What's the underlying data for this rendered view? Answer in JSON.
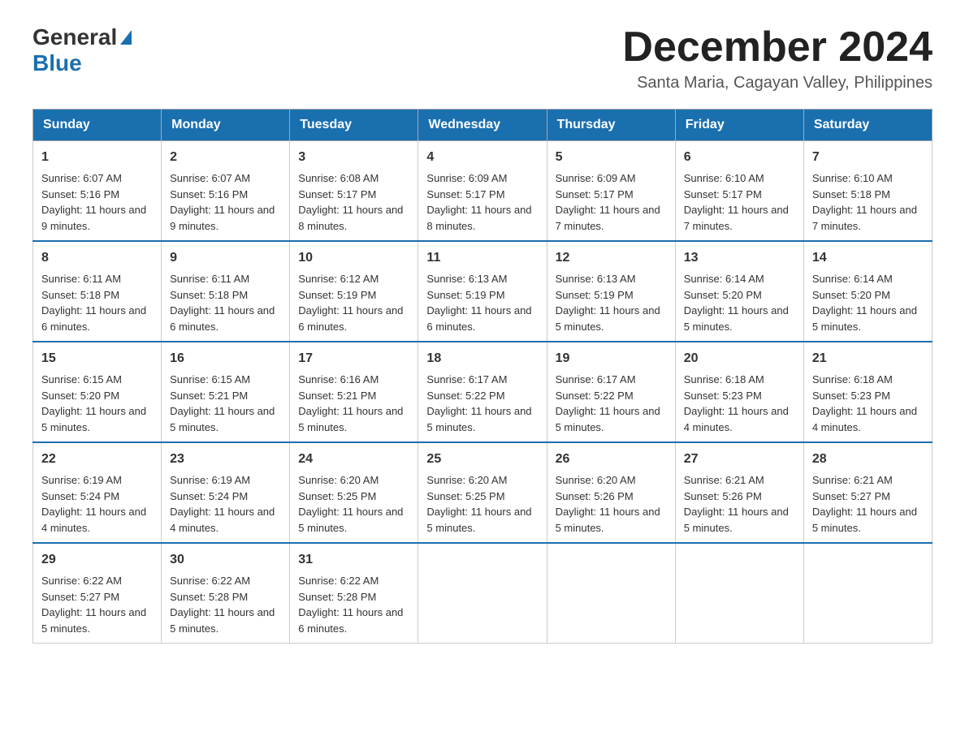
{
  "logo": {
    "general": "General",
    "blue": "Blue"
  },
  "title": "December 2024",
  "subtitle": "Santa Maria, Cagayan Valley, Philippines",
  "headers": [
    "Sunday",
    "Monday",
    "Tuesday",
    "Wednesday",
    "Thursday",
    "Friday",
    "Saturday"
  ],
  "weeks": [
    [
      {
        "day": "1",
        "sunrise": "6:07 AM",
        "sunset": "5:16 PM",
        "daylight": "11 hours and 9 minutes."
      },
      {
        "day": "2",
        "sunrise": "6:07 AM",
        "sunset": "5:16 PM",
        "daylight": "11 hours and 9 minutes."
      },
      {
        "day": "3",
        "sunrise": "6:08 AM",
        "sunset": "5:17 PM",
        "daylight": "11 hours and 8 minutes."
      },
      {
        "day": "4",
        "sunrise": "6:09 AM",
        "sunset": "5:17 PM",
        "daylight": "11 hours and 8 minutes."
      },
      {
        "day": "5",
        "sunrise": "6:09 AM",
        "sunset": "5:17 PM",
        "daylight": "11 hours and 7 minutes."
      },
      {
        "day": "6",
        "sunrise": "6:10 AM",
        "sunset": "5:17 PM",
        "daylight": "11 hours and 7 minutes."
      },
      {
        "day": "7",
        "sunrise": "6:10 AM",
        "sunset": "5:18 PM",
        "daylight": "11 hours and 7 minutes."
      }
    ],
    [
      {
        "day": "8",
        "sunrise": "6:11 AM",
        "sunset": "5:18 PM",
        "daylight": "11 hours and 6 minutes."
      },
      {
        "day": "9",
        "sunrise": "6:11 AM",
        "sunset": "5:18 PM",
        "daylight": "11 hours and 6 minutes."
      },
      {
        "day": "10",
        "sunrise": "6:12 AM",
        "sunset": "5:19 PM",
        "daylight": "11 hours and 6 minutes."
      },
      {
        "day": "11",
        "sunrise": "6:13 AM",
        "sunset": "5:19 PM",
        "daylight": "11 hours and 6 minutes."
      },
      {
        "day": "12",
        "sunrise": "6:13 AM",
        "sunset": "5:19 PM",
        "daylight": "11 hours and 5 minutes."
      },
      {
        "day": "13",
        "sunrise": "6:14 AM",
        "sunset": "5:20 PM",
        "daylight": "11 hours and 5 minutes."
      },
      {
        "day": "14",
        "sunrise": "6:14 AM",
        "sunset": "5:20 PM",
        "daylight": "11 hours and 5 minutes."
      }
    ],
    [
      {
        "day": "15",
        "sunrise": "6:15 AM",
        "sunset": "5:20 PM",
        "daylight": "11 hours and 5 minutes."
      },
      {
        "day": "16",
        "sunrise": "6:15 AM",
        "sunset": "5:21 PM",
        "daylight": "11 hours and 5 minutes."
      },
      {
        "day": "17",
        "sunrise": "6:16 AM",
        "sunset": "5:21 PM",
        "daylight": "11 hours and 5 minutes."
      },
      {
        "day": "18",
        "sunrise": "6:17 AM",
        "sunset": "5:22 PM",
        "daylight": "11 hours and 5 minutes."
      },
      {
        "day": "19",
        "sunrise": "6:17 AM",
        "sunset": "5:22 PM",
        "daylight": "11 hours and 5 minutes."
      },
      {
        "day": "20",
        "sunrise": "6:18 AM",
        "sunset": "5:23 PM",
        "daylight": "11 hours and 4 minutes."
      },
      {
        "day": "21",
        "sunrise": "6:18 AM",
        "sunset": "5:23 PM",
        "daylight": "11 hours and 4 minutes."
      }
    ],
    [
      {
        "day": "22",
        "sunrise": "6:19 AM",
        "sunset": "5:24 PM",
        "daylight": "11 hours and 4 minutes."
      },
      {
        "day": "23",
        "sunrise": "6:19 AM",
        "sunset": "5:24 PM",
        "daylight": "11 hours and 4 minutes."
      },
      {
        "day": "24",
        "sunrise": "6:20 AM",
        "sunset": "5:25 PM",
        "daylight": "11 hours and 5 minutes."
      },
      {
        "day": "25",
        "sunrise": "6:20 AM",
        "sunset": "5:25 PM",
        "daylight": "11 hours and 5 minutes."
      },
      {
        "day": "26",
        "sunrise": "6:20 AM",
        "sunset": "5:26 PM",
        "daylight": "11 hours and 5 minutes."
      },
      {
        "day": "27",
        "sunrise": "6:21 AM",
        "sunset": "5:26 PM",
        "daylight": "11 hours and 5 minutes."
      },
      {
        "day": "28",
        "sunrise": "6:21 AM",
        "sunset": "5:27 PM",
        "daylight": "11 hours and 5 minutes."
      }
    ],
    [
      {
        "day": "29",
        "sunrise": "6:22 AM",
        "sunset": "5:27 PM",
        "daylight": "11 hours and 5 minutes."
      },
      {
        "day": "30",
        "sunrise": "6:22 AM",
        "sunset": "5:28 PM",
        "daylight": "11 hours and 5 minutes."
      },
      {
        "day": "31",
        "sunrise": "6:22 AM",
        "sunset": "5:28 PM",
        "daylight": "11 hours and 6 minutes."
      },
      null,
      null,
      null,
      null
    ]
  ]
}
